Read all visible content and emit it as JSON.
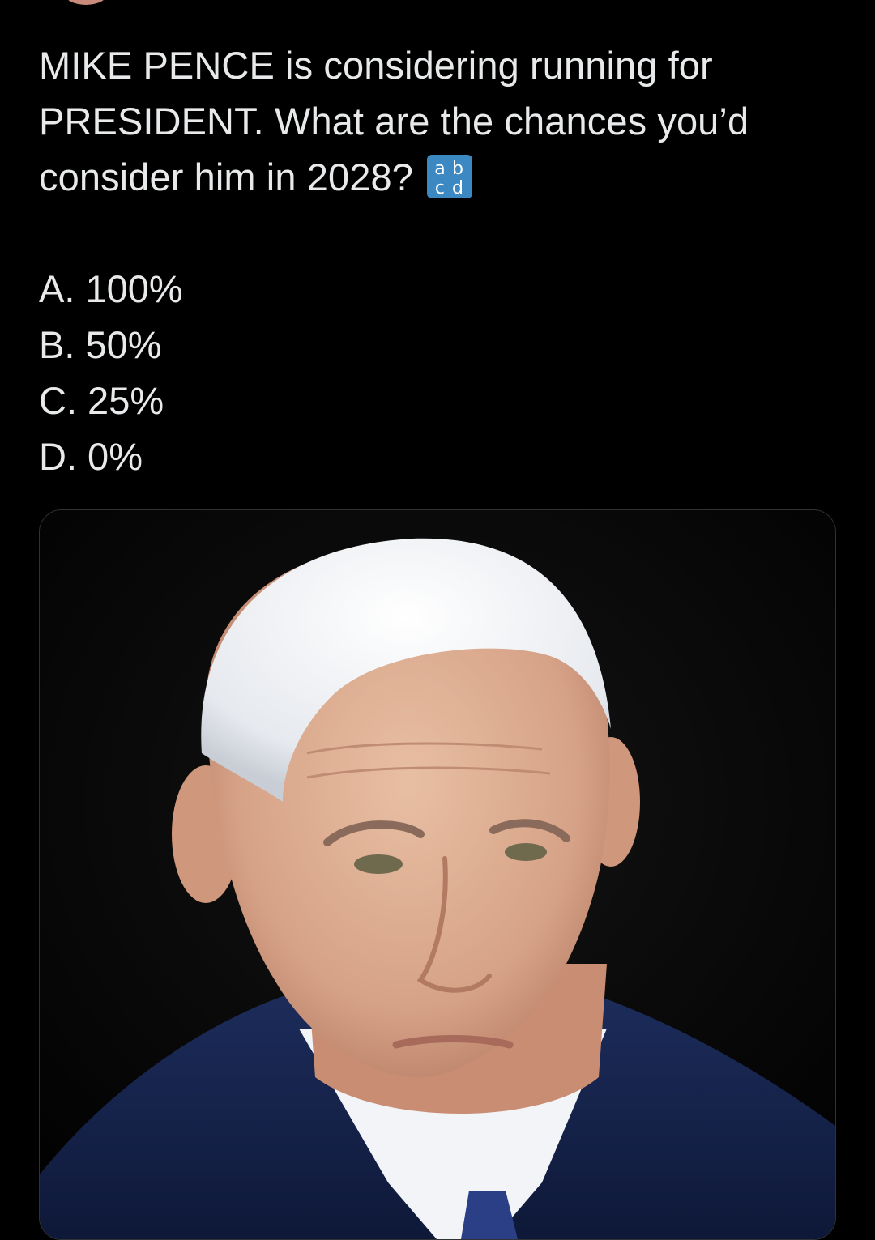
{
  "tweet": {
    "text_line1": "MIKE PENCE is considering running for",
    "text_line2": "PRESIDENT.  What are the chances you’d",
    "text_line3": "consider him in 2028?",
    "emoji": "abcd-input-icon",
    "options": [
      {
        "label": "A. 100%"
      },
      {
        "label": "B. 50%"
      },
      {
        "label": "C. 25%"
      },
      {
        "label": "D. 0%"
      }
    ]
  },
  "media": {
    "image": "portrait-photo"
  },
  "colors": {
    "background": "#000000",
    "text": "#e7e9ea",
    "media_border": "#2f3336",
    "emoji_blue": "#3b88c3"
  }
}
